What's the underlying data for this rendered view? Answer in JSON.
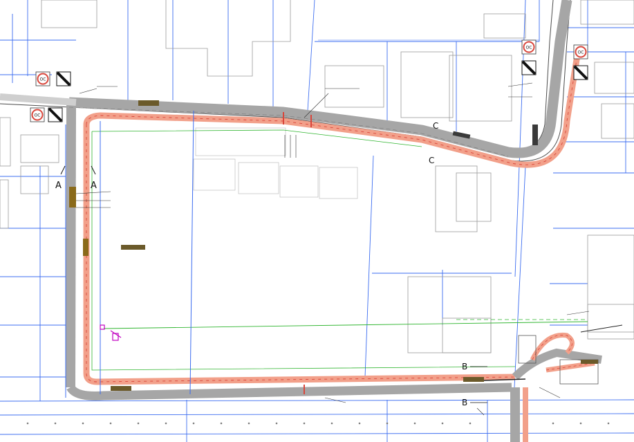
{
  "colors": {
    "parcel_line": "#3b6cf0",
    "road_gray": "#a6a6a6",
    "road_edge": "#555555",
    "bike_path": "#f2a08a",
    "bike_path_dash": "#d9463b",
    "building_line": "#8c8c8c",
    "green_line": "#2fb52f",
    "magenta": "#c000c0",
    "background": "#ffffff"
  },
  "section_markers": {
    "A": "A",
    "B": "B",
    "C": "C"
  },
  "traffic_signs": [
    {
      "icon": "no-overtaking-sign-icon",
      "text": "OC"
    },
    {
      "icon": "no-overtaking-sign-icon",
      "text": "OC"
    },
    {
      "icon": "no-overtaking-sign-icon",
      "text": "OC"
    },
    {
      "icon": "no-overtaking-sign-icon",
      "text": "OC"
    }
  ],
  "end_restriction_signs": [
    {
      "icon": "end-restriction-sign-icon"
    },
    {
      "icon": "end-restriction-sign-icon"
    },
    {
      "icon": "end-restriction-sign-icon"
    },
    {
      "icon": "end-restriction-sign-icon"
    }
  ]
}
